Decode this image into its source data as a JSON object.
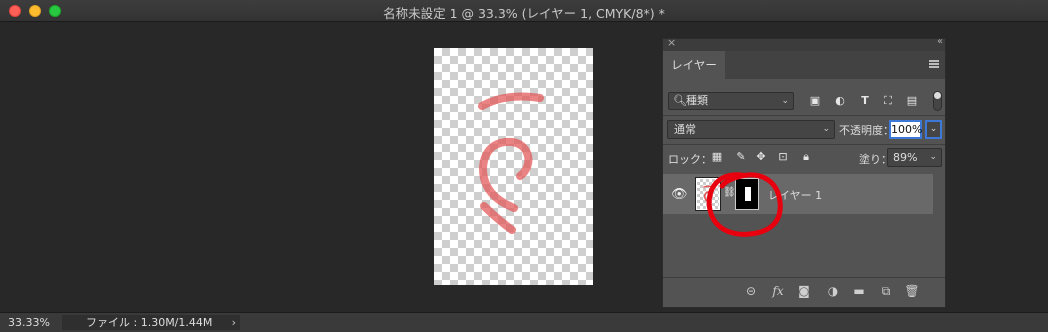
{
  "window": {
    "title": "名称未設定 1 @ 33.3% (レイヤー 1, CMYK/8*) *"
  },
  "layers_panel": {
    "tab_label": "レイヤー",
    "filter": {
      "value": "種類",
      "icons": [
        "image-filter-icon",
        "adjustment-filter-icon",
        "text-filter-icon",
        "shape-filter-icon",
        "smart-object-filter-icon"
      ]
    },
    "blend_mode": "通常",
    "opacity_label": "不透明度：",
    "opacity_value": "100%",
    "lock_label": "ロック：",
    "lock_icons": [
      "lock-transparent-pixels-icon",
      "lock-image-pixels-icon",
      "lock-position-icon",
      "lock-artboard-icon",
      "lock-all-icon"
    ],
    "fill_label": "塗り：",
    "fill_value": "89%",
    "layers": [
      {
        "name": "レイヤー 1",
        "visible": true,
        "has_mask": true,
        "selected": true
      }
    ],
    "footer_icons": [
      "link-layers-icon",
      "fx-icon",
      "add-mask-icon",
      "adjustment-layer-icon",
      "group-folder-icon",
      "new-layer-icon",
      "trash-icon"
    ],
    "fx_label": "fx"
  },
  "status_bar": {
    "zoom": "33.33%",
    "file_info": "ファイル : 1.30M/1.44M"
  },
  "colors": {
    "annotation": "#e8000e",
    "brush_stroke": "#e35a5a",
    "panel_bg": "#535353",
    "app_bg": "#282828",
    "selection_blue": "#3b78d8"
  }
}
